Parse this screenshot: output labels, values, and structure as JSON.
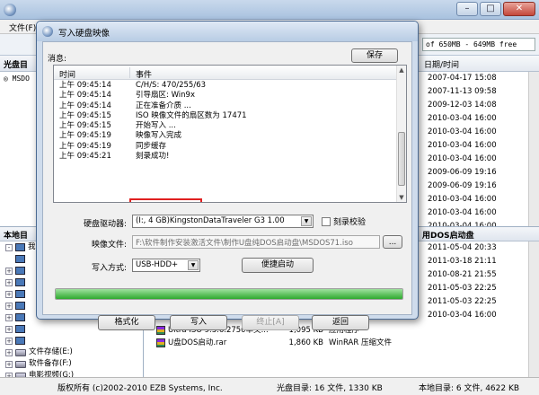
{
  "menubar": {
    "file_menu": "文件(F)"
  },
  "toolbar": {
    "size_readout": "of 650MB - 649MB free"
  },
  "left_upper": {
    "header": "光盘目",
    "item": "MSDO"
  },
  "right_upper": {
    "header": "日期/时间",
    "dates": [
      "2007-04-17 15:08",
      "2007-11-13 09:58",
      "2009-12-03 14:08",
      "2010-03-04 16:00",
      "2010-03-04 16:00",
      "2010-03-04 16:00",
      "2010-03-04 16:00",
      "2009-06-09 19:16",
      "2009-06-09 19:16",
      "2010-03-04 16:00",
      "2010-03-04 16:00",
      "2010-03-04 16:00"
    ]
  },
  "left_lower": {
    "header": "本地目",
    "items": [
      {
        "box": "-",
        "label": "我的"
      },
      {
        "box": "",
        "label": ""
      },
      {
        "box": "+",
        "label": ""
      },
      {
        "box": "+",
        "label": ""
      },
      {
        "box": "+",
        "label": ""
      },
      {
        "box": "+",
        "label": ""
      },
      {
        "box": "+",
        "label": ""
      },
      {
        "box": "+",
        "label": ""
      },
      {
        "box": "+",
        "label": ""
      },
      {
        "box": "+",
        "label": "文件存储(E:)"
      },
      {
        "box": "+",
        "label": "软件备存(F:)"
      },
      {
        "box": "+",
        "label": "电影视频(G:)"
      },
      {
        "box": "+",
        "label": "CD 驱动器(H:)"
      },
      {
        "box": "+",
        "label": "(I:)"
      }
    ]
  },
  "right_lower": {
    "header": "用DOS启动盘",
    "dates": [
      "2011-05-04 20:33",
      "2011-03-18 21:11",
      "2010-08-21 21:55",
      "2011-05-03 22:25",
      "2011-05-03 22:25",
      "2010-03-04 16:00"
    ],
    "files": [
      {
        "name": "Ultra ISO 9.3.6.2750单文...",
        "size": "1,095 KB",
        "type": "应用程序",
        "date": "2011-05-03 22:25"
      },
      {
        "name": "U盘DOS启动.rar",
        "size": "1,860 KB",
        "type": "WinRAR 压缩文件",
        "date": "2011-05-03 22:18"
      }
    ]
  },
  "status": {
    "copyright": "版权所有 (c)2002-2010 EZB Systems, Inc.",
    "disc_dir": "光盘目录: 16 文件, 1330 KB",
    "local_dir": "本地目录: 6 文件, 4622 KB"
  },
  "dialog": {
    "title": "写入硬盘映像",
    "message_label": "消息:",
    "save_button": "保存",
    "log_headers": {
      "time": "时间",
      "event": "事件"
    },
    "log": [
      {
        "time": "上午 09:45:14",
        "event": "C/H/S: 470/255/63"
      },
      {
        "time": "上午 09:45:14",
        "event": "引导扇区: Win9x"
      },
      {
        "time": "上午 09:45:14",
        "event": "正在准备介质 ..."
      },
      {
        "time": "上午 09:45:15",
        "event": "ISO 映像文件的扇区数为 17471"
      },
      {
        "time": "上午 09:45:15",
        "event": "开始写入 ..."
      },
      {
        "time": "上午 09:45:19",
        "event": "映像写入完成"
      },
      {
        "time": "上午 09:45:19",
        "event": "同步缓存"
      },
      {
        "time": "上午 09:45:21",
        "event": "刻录成功!"
      }
    ],
    "drive_label": "硬盘驱动器:",
    "drive_value": "(I:, 4 GB)KingstonDataTraveler G3 1.00",
    "verify_label": "刻录校验",
    "image_label": "映像文件:",
    "image_value": "F:\\软件制作安装激活文件\\制作U盘纯DOS启动盘\\MSDOS71.iso",
    "mode_label": "写入方式:",
    "mode_value": "USB-HDD+",
    "quickboot_button": "便捷启动",
    "progress_fraction": 1.0,
    "buttons": {
      "format": "格式化",
      "write": "写入",
      "abort": "终止[A]",
      "back": "返回"
    },
    "browse_button": "..."
  }
}
